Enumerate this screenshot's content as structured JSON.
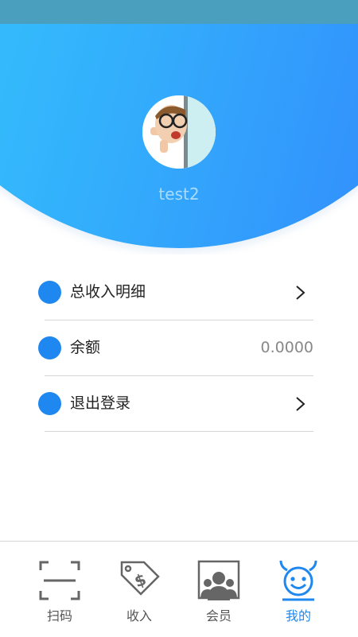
{
  "profile": {
    "username": "test2"
  },
  "menu": {
    "items": [
      {
        "label": "总收入明细"
      },
      {
        "label": "余额",
        "value": "0.0000"
      },
      {
        "label": "退出登录"
      }
    ]
  },
  "tabbar": {
    "tabs": [
      {
        "label": "扫码",
        "icon": "scan-icon"
      },
      {
        "label": "收入",
        "icon": "income-tag-icon"
      },
      {
        "label": "会员",
        "icon": "members-icon"
      },
      {
        "label": "我的",
        "icon": "devil-face-icon",
        "active": true
      }
    ]
  },
  "colors": {
    "accent": "#1e87f0",
    "header_gradient_start": "#35d3fb",
    "header_gradient_end": "#3282fb",
    "status_bar": "#4b9fbe",
    "username": "#a9dcff",
    "inactive_tab": "#555555"
  }
}
